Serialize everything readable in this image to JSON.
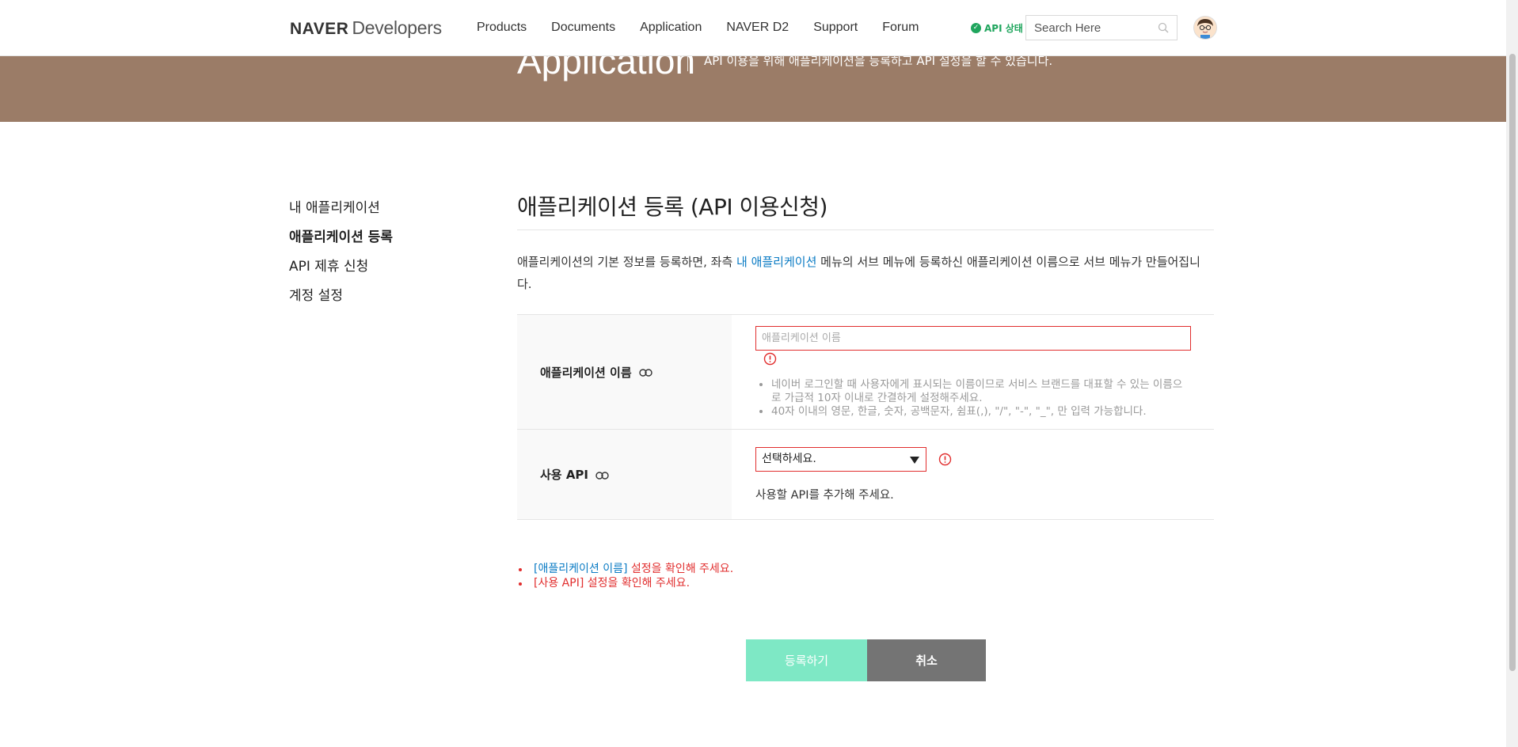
{
  "header": {
    "logo_brand": "NAVER",
    "logo_sub": "Developers",
    "nav": [
      "Products",
      "Documents",
      "Application",
      "NAVER D2",
      "Support",
      "Forum"
    ],
    "api_status": "API 상태",
    "search_placeholder": "Search Here"
  },
  "hero": {
    "title": "Application",
    "desc": "API 이용을 위해 애플리케이션을 등록하고 API 설정을 할 수 있습니다."
  },
  "sidebar": {
    "items": [
      {
        "label": "내 애플리케이션",
        "active": false
      },
      {
        "label": "애플리케이션 등록",
        "active": true
      },
      {
        "label": "API 제휴 신청",
        "active": false
      },
      {
        "label": "계정 설정",
        "active": false
      }
    ]
  },
  "main": {
    "title": "애플리케이션 등록 (API 이용신청)",
    "intro_before": "애플리케이션의 기본 정보를 등록하면, 좌측 ",
    "intro_link": "내 애플리케이션",
    "intro_after": " 메뉴의 서브 메뉴에 등록하신 애플리케이션 이름으로 서브 메뉴가 만들어집니다.",
    "form": {
      "app_name_label": "애플리케이션 이름",
      "app_name_placeholder": "애플리케이션 이름",
      "app_name_value": "",
      "hints": [
        "네이버 로그인할 때 사용자에게 표시되는 이름이므로 서비스 브랜드를 대표할 수 있는 이름으로 가급적 10자 이내로 간결하게 설정해주세요.",
        "40자 이내의 영문, 한글, 숫자, 공백문자, 쉼표(,), \"/\", \"-\", \"_\", 만 입력 가능합니다."
      ],
      "api_label": "사용 API",
      "api_select_value": "선택하세요.",
      "api_add_text": "사용할 API를 추가해 주세요."
    },
    "errors": [
      {
        "field": "[애플리케이션 이름]",
        "msg": " 설정을 확인해 주세요."
      },
      {
        "field": "[사용 API]",
        "msg": " 설정을 확인해 주세요."
      }
    ],
    "buttons": {
      "submit": "등록하기",
      "cancel": "취소"
    }
  },
  "colors": {
    "hero_bg": "#9b7c67",
    "error": "#e12d2d",
    "link": "#0a7bc4",
    "submit_bg": "#7ee8c5",
    "cancel_bg": "#747474",
    "status_green": "#1fa55d"
  }
}
